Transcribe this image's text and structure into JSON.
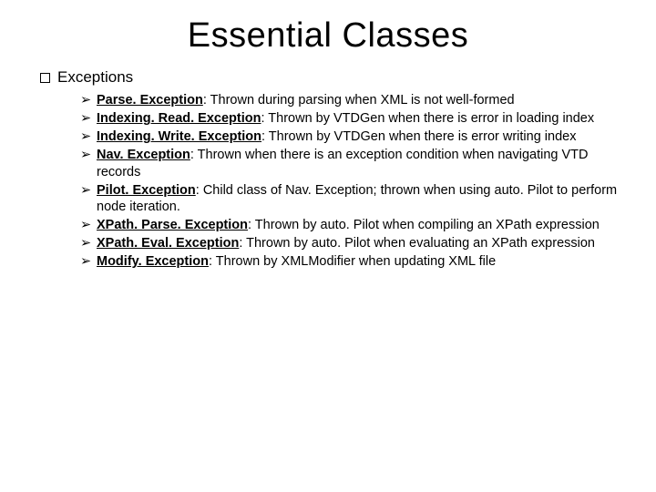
{
  "title": "Essential Classes",
  "section_label": "Exceptions",
  "items": [
    {
      "name": "Parse. Exception",
      "desc": ": Thrown during parsing when XML is not well-formed"
    },
    {
      "name": "Indexing. Read. Exception",
      "desc": ": Thrown by VTDGen when there is error in loading index"
    },
    {
      "name": "Indexing. Write. Exception",
      "desc": ": Thrown by VTDGen when there is error writing index"
    },
    {
      "name": "Nav. Exception",
      "desc": ": Thrown when there is an exception condition when navigating VTD records"
    },
    {
      "name": "Pilot. Exception",
      "desc": ": Child class of Nav. Exception; thrown when using auto. Pilot to perform node iteration."
    },
    {
      "name": "XPath. Parse. Exception",
      "desc": ": Thrown by auto. Pilot when compiling an XPath expression"
    },
    {
      "name": "XPath. Eval. Exception",
      "desc": ": Thrown by auto. Pilot when evaluating an XPath expression"
    },
    {
      "name": "Modify. Exception",
      "desc": ": Thrown by XMLModifier when updating XML file"
    }
  ]
}
